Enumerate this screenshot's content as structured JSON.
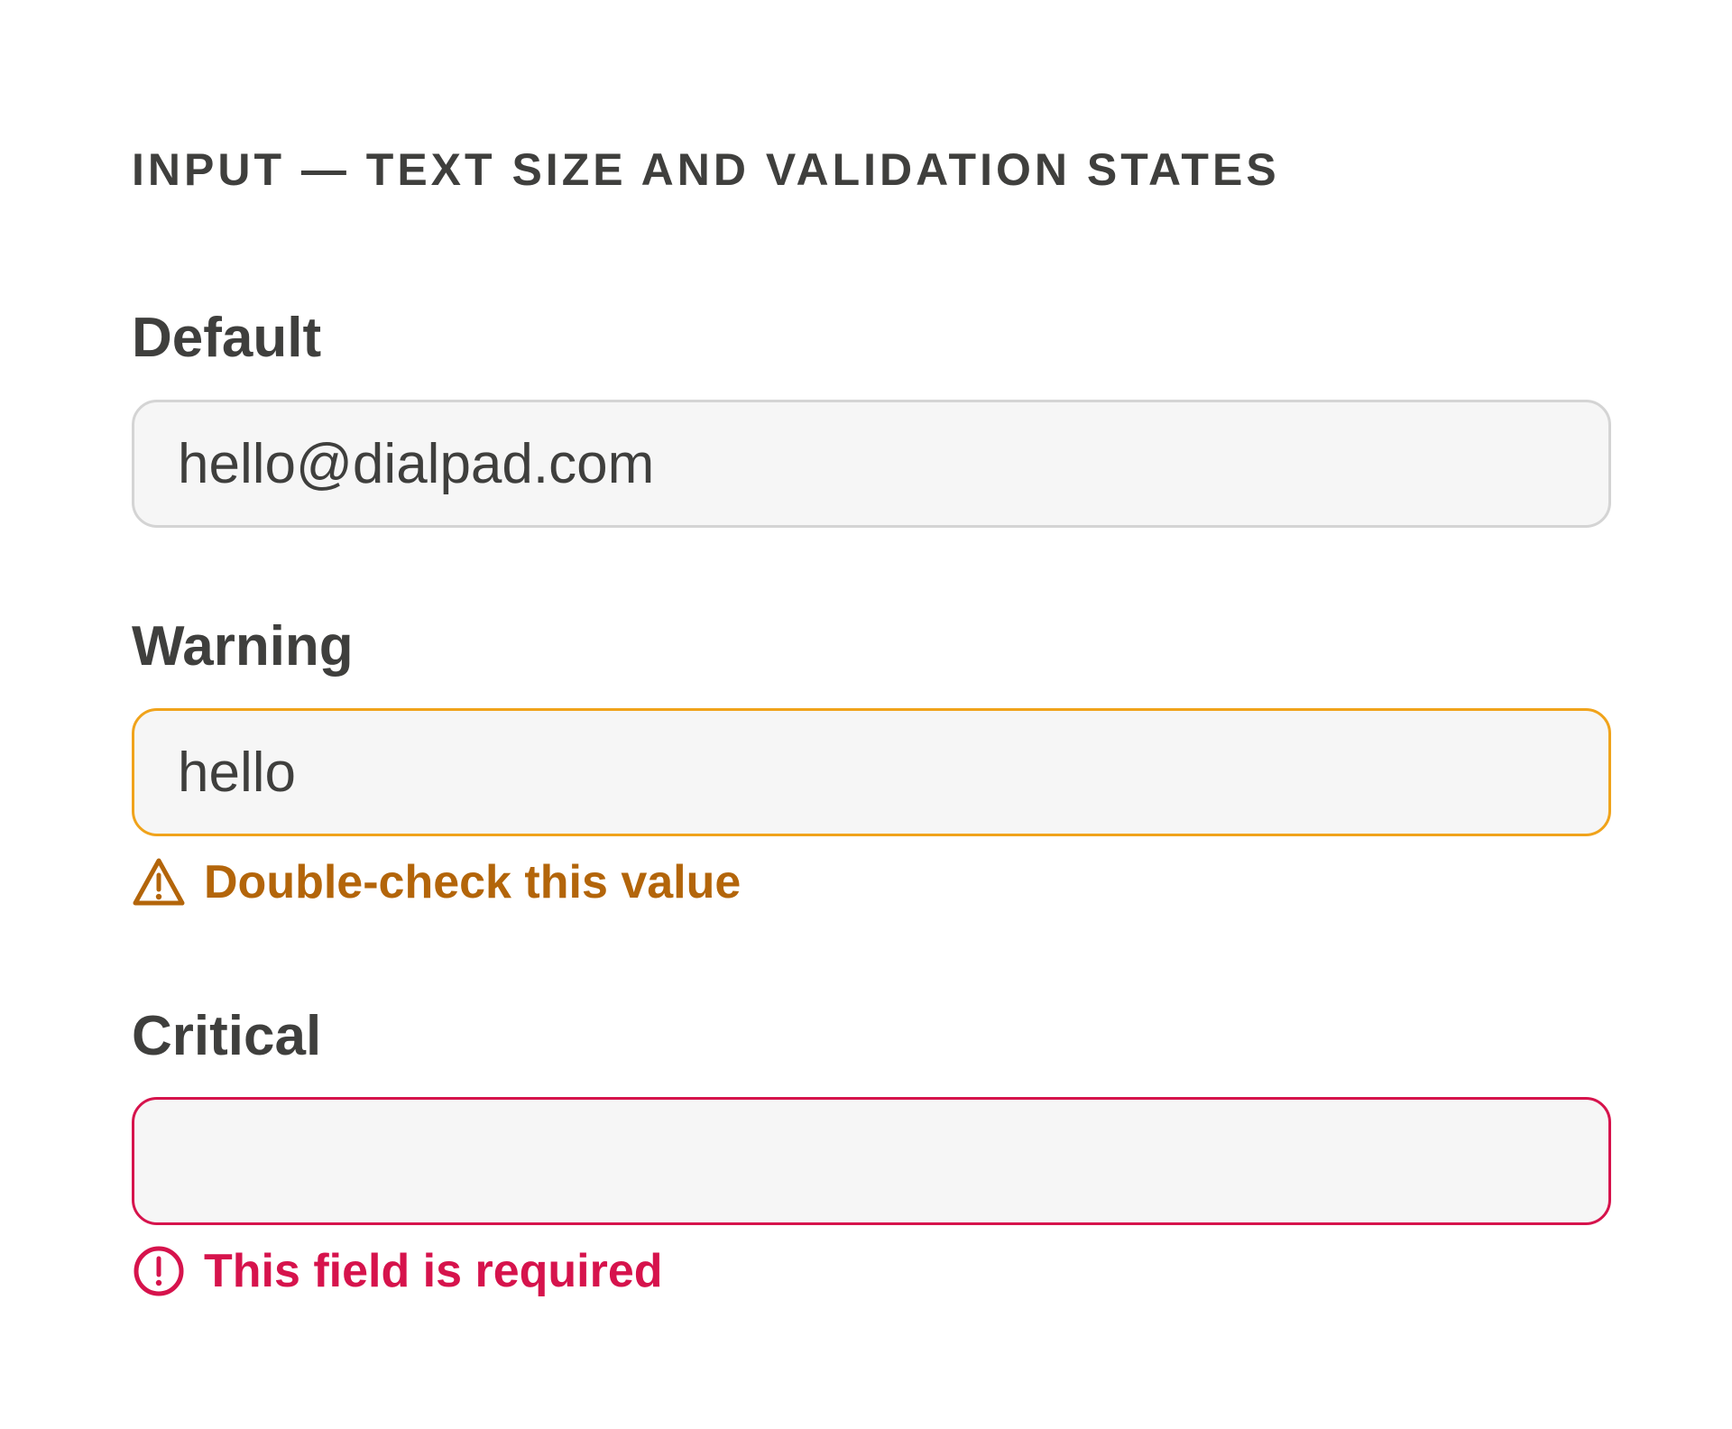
{
  "section_title": "INPUT — TEXT SIZE AND VALIDATION STATES",
  "fields": {
    "default": {
      "label": "Default",
      "value": "hello@dialpad.com",
      "placeholder": ""
    },
    "warning": {
      "label": "Warning",
      "value": "hello",
      "placeholder": "",
      "message": "Double-check this value",
      "icon": "warning-triangle-icon",
      "color": "#f0a31b",
      "message_color": "#b3650a"
    },
    "critical": {
      "label": "Critical",
      "value": "",
      "placeholder": "",
      "message": "This field is required",
      "icon": "alert-circle-icon",
      "color": "#d6134c",
      "message_color": "#d6134c"
    }
  }
}
